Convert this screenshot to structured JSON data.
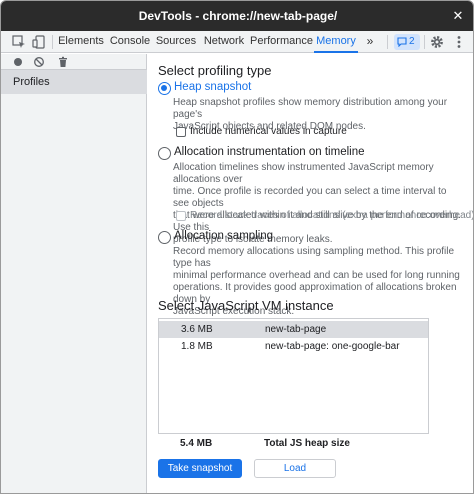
{
  "window": {
    "title": "DevTools - chrome://new-tab-page/",
    "close_icon": "close-icon"
  },
  "tabbar": {
    "tabs": [
      {
        "label": "Elements",
        "active": false
      },
      {
        "label": "Console",
        "active": false
      },
      {
        "label": "Sources",
        "active": false
      },
      {
        "label": "Network",
        "active": false
      },
      {
        "label": "Performance",
        "active": false
      },
      {
        "label": "Memory",
        "active": true
      }
    ],
    "more_label": "»",
    "issues_count": "2",
    "icons": [
      "inspect-element-icon",
      "device-toolbar-icon",
      "issues-icon",
      "settings-gear-icon",
      "more-options-icon"
    ]
  },
  "sidebar": {
    "toolbar_icons": [
      "record-icon",
      "clear-icon",
      "trash-icon"
    ],
    "section_label": "Profiles"
  },
  "profiling": {
    "heading": "Select profiling type",
    "options": [
      {
        "label": "Heap snapshot",
        "checked": true,
        "description": [
          "Heap snapshot profiles show memory distribution among your page's",
          "JavaScript objects and related DOM nodes."
        ],
        "checkbox": {
          "label": "Include numerical values in capture",
          "checked": false,
          "disabled": false
        }
      },
      {
        "label": "Allocation instrumentation on timeline",
        "checked": false,
        "description": [
          "Allocation timelines show instrumented JavaScript memory allocations over",
          "time. Once profile is recorded you can select a time interval to see objects",
          "that were allocated within it and still alive by the end of recording. Use this",
          "profile type to isolate memory leaks."
        ],
        "checkbox": {
          "label": "Record stack traces of allocations (extra performance overhead)",
          "checked": false,
          "disabled": true
        }
      },
      {
        "label": "Allocation sampling",
        "checked": false,
        "description": [
          "Record memory allocations using sampling method. This profile type has",
          "minimal performance overhead and can be used for long running",
          "operations. It provides good approximation of allocations broken down by",
          "JavaScript execution stack."
        ]
      }
    ]
  },
  "vm": {
    "heading": "Select JavaScript VM instance",
    "rows": [
      {
        "size": "3.6 MB",
        "name": "new-tab-page",
        "selected": true
      },
      {
        "size": "1.8 MB",
        "name": "new-tab-page: one-google-bar",
        "selected": false
      }
    ],
    "total_size": "5.4 MB",
    "total_label": "Total JS heap size"
  },
  "actions": {
    "primary_label": "Take snapshot",
    "secondary_label": "Load"
  },
  "colors": {
    "accent": "#1a73e8",
    "titlebar": "#2b2b2b",
    "toolbar_bg": "#f1f3f4",
    "selected_row": "#dadce0"
  }
}
